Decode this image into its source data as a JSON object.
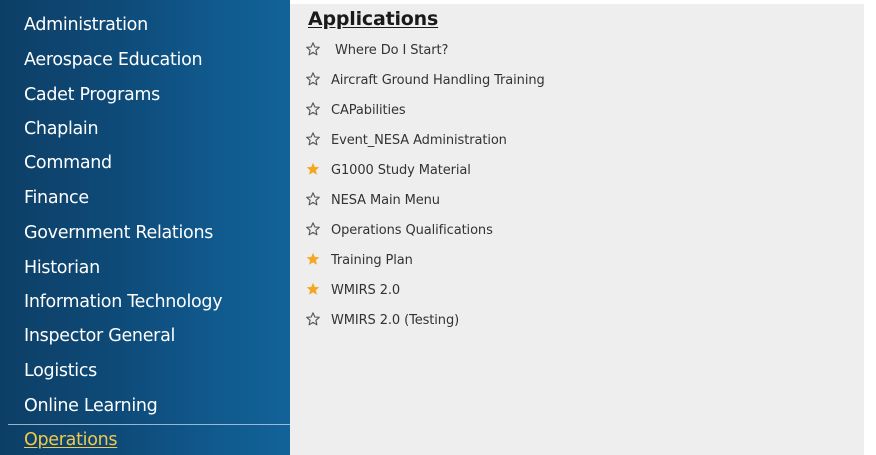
{
  "sidebar": {
    "items": [
      {
        "label": "Administration",
        "active": false
      },
      {
        "label": "Aerospace Education",
        "active": false
      },
      {
        "label": "Cadet Programs",
        "active": false
      },
      {
        "label": "Chaplain",
        "active": false
      },
      {
        "label": "Command",
        "active": false
      },
      {
        "label": "Finance",
        "active": false
      },
      {
        "label": "Government Relations",
        "active": false
      },
      {
        "label": "Historian",
        "active": false
      },
      {
        "label": "Information Technology",
        "active": false
      },
      {
        "label": "Inspector General",
        "active": false
      },
      {
        "label": "Logistics",
        "active": false
      },
      {
        "label": "Online Learning",
        "active": false
      },
      {
        "label": "Operations",
        "active": true
      }
    ]
  },
  "main": {
    "title": "Applications",
    "apps": [
      {
        "label": " Where Do I Start?",
        "favorite": false,
        "icon": "star-outline-icon"
      },
      {
        "label": "Aircraft Ground Handling Training",
        "favorite": false,
        "icon": "star-outline-icon"
      },
      {
        "label": "CAPabilities",
        "favorite": false,
        "icon": "star-outline-icon"
      },
      {
        "label": "Event_NESA Administration",
        "favorite": false,
        "icon": "star-outline-icon"
      },
      {
        "label": "G1000 Study Material",
        "favorite": true,
        "icon": "star-filled-icon"
      },
      {
        "label": "NESA Main Menu",
        "favorite": false,
        "icon": "star-outline-icon"
      },
      {
        "label": "Operations Qualifications",
        "favorite": false,
        "icon": "star-outline-icon"
      },
      {
        "label": "Training Plan",
        "favorite": true,
        "icon": "star-filled-icon"
      },
      {
        "label": "WMIRS 2.0",
        "favorite": true,
        "icon": "star-filled-icon"
      },
      {
        "label": "WMIRS 2.0 (Testing)",
        "favorite": false,
        "icon": "star-outline-icon"
      }
    ]
  },
  "colors": {
    "sidebar_bg": "#0e4a78",
    "active_link": "#f2c94c",
    "star_filled": "#f5a623",
    "star_outline": "#555555",
    "main_bg": "#eeeeee"
  }
}
